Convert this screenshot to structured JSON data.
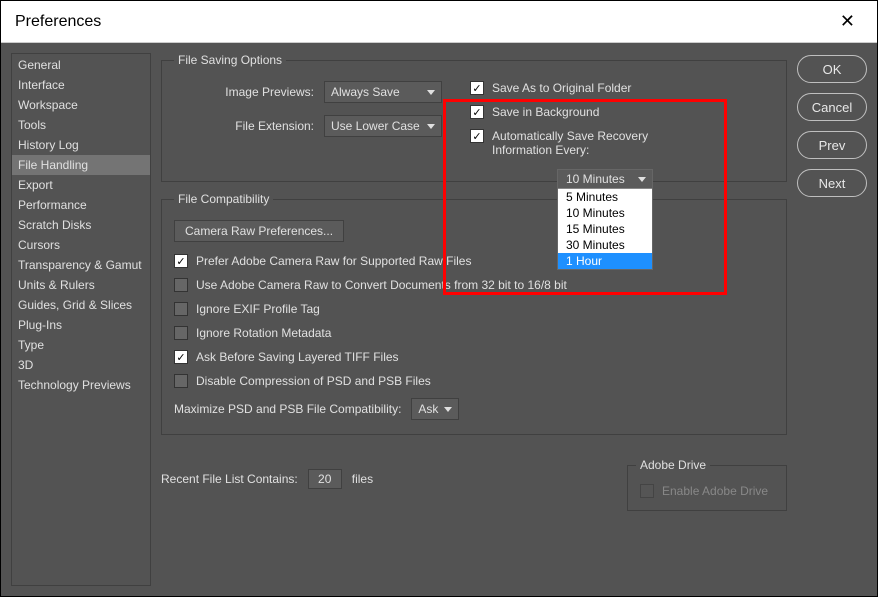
{
  "window": {
    "title": "Preferences"
  },
  "sidebar": {
    "items": [
      "General",
      "Interface",
      "Workspace",
      "Tools",
      "History Log",
      "File Handling",
      "Export",
      "Performance",
      "Scratch Disks",
      "Cursors",
      "Transparency & Gamut",
      "Units & Rulers",
      "Guides, Grid & Slices",
      "Plug-Ins",
      "Type",
      "3D",
      "Technology Previews"
    ],
    "selected_index": 5
  },
  "buttons": {
    "ok": "OK",
    "cancel": "Cancel",
    "prev": "Prev",
    "next": "Next"
  },
  "file_saving": {
    "legend": "File Saving Options",
    "image_previews_label": "Image Previews:",
    "image_previews_value": "Always Save",
    "file_extension_label": "File Extension:",
    "file_extension_value": "Use Lower Case",
    "save_as_original": {
      "label": "Save As to Original Folder",
      "checked": true
    },
    "save_background": {
      "label": "Save in Background",
      "checked": true
    },
    "auto_save": {
      "label": "Automatically Save Recovery Information Every:",
      "checked": true
    },
    "interval_selected": "10 Minutes",
    "interval_options": [
      "5 Minutes",
      "10 Minutes",
      "15 Minutes",
      "30 Minutes",
      "1 Hour"
    ],
    "interval_highlight_index": 4
  },
  "file_compat": {
    "legend": "File Compatibility",
    "camera_raw_btn": "Camera Raw Preferences...",
    "prefer_raw": {
      "label": "Prefer Adobe Camera Raw for Supported Raw Files",
      "checked": true
    },
    "use_raw_convert": {
      "label": "Use Adobe Camera Raw to Convert Documents from 32 bit to 16/8 bit",
      "checked": false
    },
    "ignore_exif": {
      "label": "Ignore EXIF Profile Tag",
      "checked": false
    },
    "ignore_rotation": {
      "label": "Ignore Rotation Metadata",
      "checked": false
    },
    "ask_tiff": {
      "label": "Ask Before Saving Layered TIFF Files",
      "checked": true
    },
    "disable_psd": {
      "label": "Disable Compression of PSD and PSB Files",
      "checked": false
    },
    "maximize_label": "Maximize PSD and PSB File Compatibility:",
    "maximize_value": "Ask"
  },
  "recent": {
    "label": "Recent File List Contains:",
    "value": "20",
    "unit": "files"
  },
  "adobe_drive": {
    "legend": "Adobe Drive",
    "enable_label": "Enable Adobe Drive"
  }
}
